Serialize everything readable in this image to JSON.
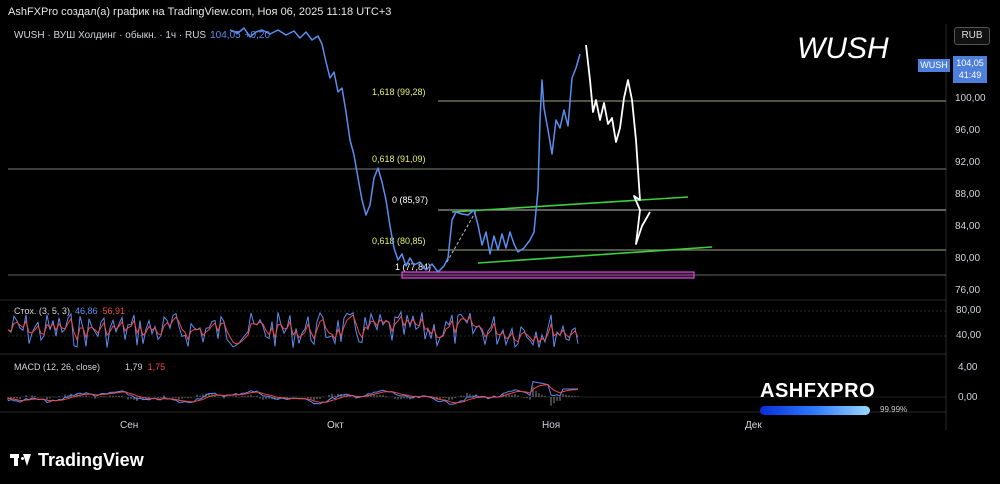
{
  "header": {
    "attribution": "AshFXPro создал(а) график на TradingView.com, Ноя 06, 2025 11:18 UTC+3"
  },
  "legend": {
    "symbol_desc": "WUSH · ВУШ Холдинг · обыкн. · 1ч · RUS",
    "price": "104,05",
    "change": "+0,20"
  },
  "currency": "RUB",
  "title": "WUSH",
  "price_label": {
    "symbol": "WUSH",
    "price": "104,05",
    "countdown": "41:49"
  },
  "fib_levels": [
    {
      "label": "1,618 (99,28)",
      "price": 99.28
    },
    {
      "label": "0,618 (91,09)",
      "price": 91.09
    },
    {
      "label": "0 (85,97)",
      "price": 85.97
    },
    {
      "label": "0,618 (80,85)",
      "price": 80.85
    },
    {
      "label": "1 (77,84)",
      "price": 77.84
    }
  ],
  "price_axis": [
    "100,00",
    "96,00",
    "92,00",
    "88,00",
    "84,00",
    "80,00",
    "76,00"
  ],
  "stoch": {
    "name": "Стох. (3, 5, 3)",
    "k": "46,86",
    "d": "56,91",
    "axis": [
      "80,00",
      "40,00"
    ]
  },
  "macd": {
    "name": "MACD (12, 26, close)",
    "macd": "1,79",
    "signal": "1,75",
    "axis": [
      "4,00",
      "0,00"
    ]
  },
  "time_axis": [
    "Сен",
    "Окт",
    "Ноя",
    "Дек"
  ],
  "watermark": {
    "text": "ASHFXPRO",
    "percent": "99.99%"
  },
  "brand": "TradingView",
  "colors": {
    "price_line": "#5b8def",
    "channel": "#3ecf3e",
    "fib_label": "#e8f06a",
    "support_box": "#d84bd8",
    "stoch_k": "#5b8def",
    "stoch_d": "#f0484a"
  }
}
